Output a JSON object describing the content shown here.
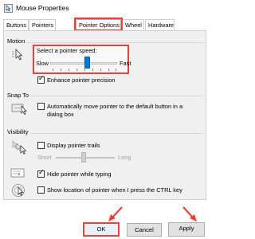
{
  "window": {
    "title": "Mouse Properties"
  },
  "tabs": [
    {
      "label": "Buttons"
    },
    {
      "label": "Pointers"
    },
    {
      "label": "Pointer Options"
    },
    {
      "label": "Wheel"
    },
    {
      "label": "Hardware"
    }
  ],
  "motion": {
    "group_label": "Motion",
    "speed_label": "Select a pointer speed:",
    "slow_label": "Slow",
    "fast_label": "Fast",
    "speed_level": 0.55,
    "precision_label": "Enhance pointer precision",
    "precision_checked": true
  },
  "snap_to": {
    "group_label": "Snap To",
    "checkbox_label_line1": "Automatically move pointer to the default button in a",
    "checkbox_label_line2": "dialog box",
    "checked": false
  },
  "visibility": {
    "group_label": "Visibility",
    "trails_label": "Display pointer trails",
    "trails_checked": false,
    "short_label": "Short",
    "long_label": "Long",
    "hide_label": "Hide pointer while typing",
    "hide_checked": true,
    "show_location_label": "Show location of pointer when I press the CTRL key",
    "show_location_checked": false
  },
  "buttons": {
    "ok": "OK",
    "cancel": "Cancel",
    "apply": "Apply"
  },
  "colors": {
    "annotation": "#e8423a",
    "accent": "#0078d7"
  }
}
